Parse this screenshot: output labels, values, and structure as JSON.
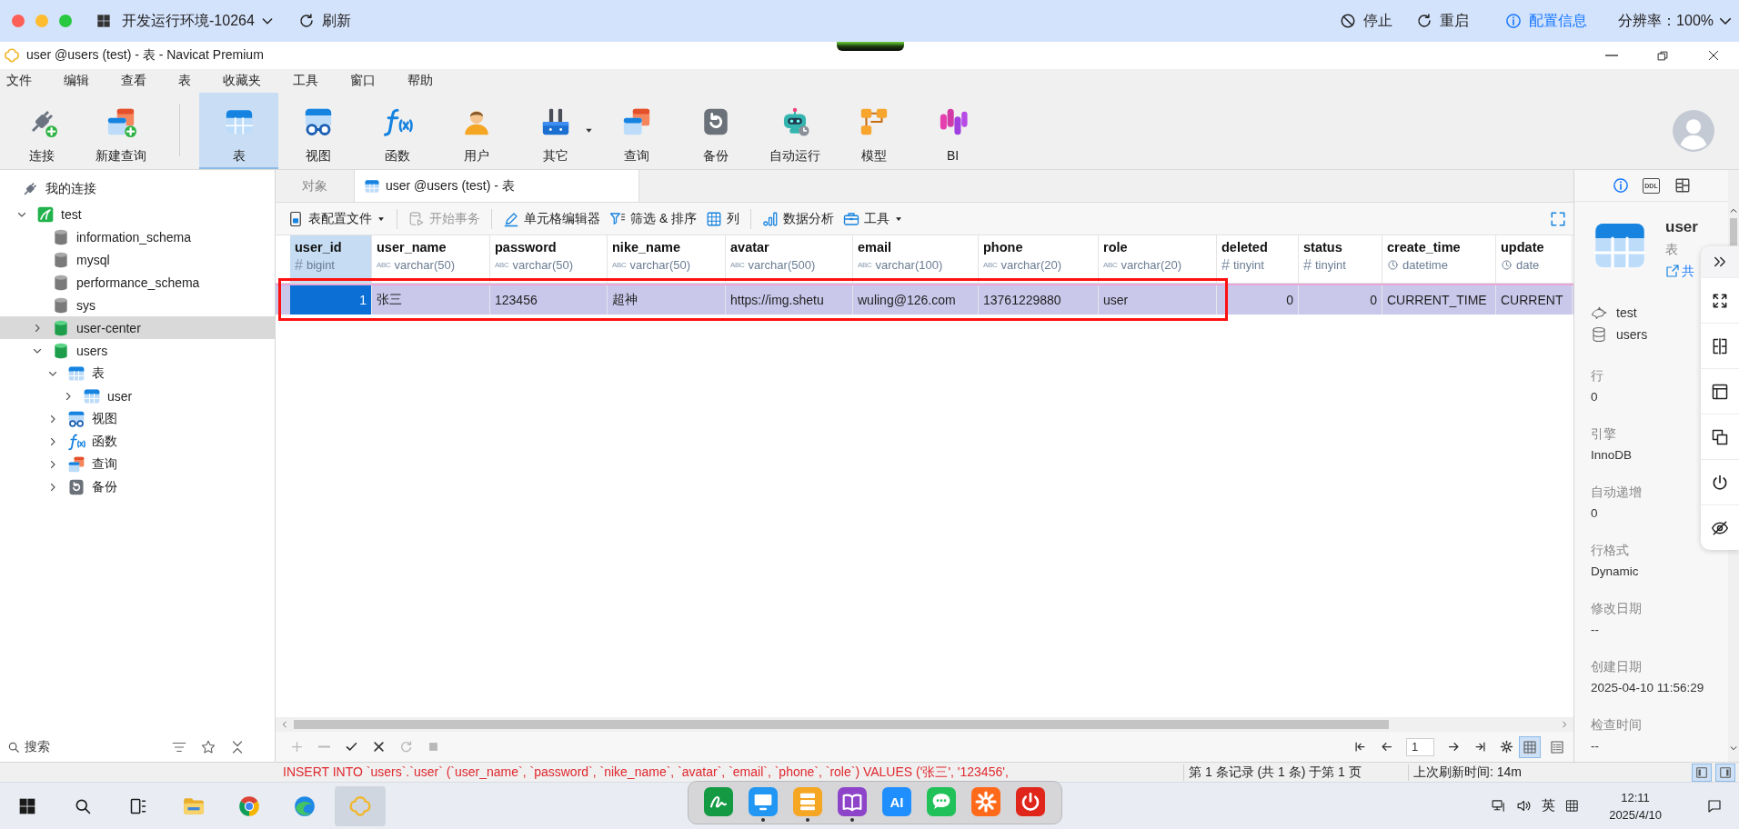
{
  "remote_bar": {
    "title": "开发运行环境-10264",
    "refresh": "刷新",
    "actions": [
      {
        "kind": "stop",
        "label": "停止"
      },
      {
        "kind": "restart",
        "label": "重启"
      },
      {
        "kind": "config",
        "label": "配置信息"
      }
    ],
    "resolution": "分辨率：100%"
  },
  "window": {
    "title": "user @users (test) - 表 - Navicat Premium"
  },
  "menu": [
    "文件",
    "编辑",
    "查看",
    "表",
    "收藏夹",
    "工具",
    "窗口",
    "帮助"
  ],
  "toolbar": {
    "groups": [
      [
        {
          "kind": "connect",
          "label": "连接",
          "selected": false,
          "dropdown": false
        },
        {
          "kind": "new-query",
          "label": "新建查询",
          "selected": false,
          "dropdown": false
        }
      ],
      [
        {
          "kind": "table",
          "label": "表",
          "selected": true,
          "dropdown": false
        },
        {
          "kind": "view",
          "label": "视图",
          "selected": false,
          "dropdown": false
        },
        {
          "kind": "function",
          "label": "函数",
          "selected": false,
          "dropdown": false
        },
        {
          "kind": "user",
          "label": "用户",
          "selected": false,
          "dropdown": false
        },
        {
          "kind": "other",
          "label": "其它",
          "selected": false,
          "dropdown": true
        },
        {
          "kind": "query",
          "label": "查询",
          "selected": false,
          "dropdown": false
        },
        {
          "kind": "backup",
          "label": "备份",
          "selected": false,
          "dropdown": false
        },
        {
          "kind": "automation",
          "label": "自动运行",
          "selected": false,
          "dropdown": false
        },
        {
          "kind": "model",
          "label": "模型",
          "selected": false,
          "dropdown": false
        },
        {
          "kind": "bi",
          "label": "BI",
          "selected": false,
          "dropdown": false
        }
      ]
    ]
  },
  "sidebar": {
    "tree": [
      {
        "kind": "connections",
        "label": "我的连接",
        "selected": false,
        "children": [
          {
            "kind": "server",
            "label": "test",
            "selected": false,
            "expanded": true,
            "children": [
              {
                "kind": "database",
                "label": "information_schema",
                "selected": false,
                "open": false
              },
              {
                "kind": "database",
                "label": "mysql",
                "selected": false,
                "open": false
              },
              {
                "kind": "database",
                "label": "performance_schema",
                "selected": false,
                "open": false
              },
              {
                "kind": "database",
                "label": "sys",
                "selected": false,
                "open": false
              },
              {
                "kind": "database",
                "label": "user-center",
                "selected": true,
                "open": true,
                "expanded": false
              },
              {
                "kind": "database",
                "label": "users",
                "selected": false,
                "open": true,
                "expanded": true,
                "children": [
                  {
                    "kind": "tables",
                    "label": "表",
                    "selected": false,
                    "expanded": true,
                    "children": [
                      {
                        "kind": "table",
                        "label": "user",
                        "selected": false,
                        "expanded": false
                      }
                    ]
                  },
                  {
                    "kind": "views",
                    "label": "视图",
                    "selected": false,
                    "expanded": false
                  },
                  {
                    "kind": "functions",
                    "label": "函数",
                    "selected": false,
                    "expanded": false
                  },
                  {
                    "kind": "queries",
                    "label": "查询",
                    "selected": false,
                    "expanded": false
                  },
                  {
                    "kind": "backups",
                    "label": "备份",
                    "selected": false,
                    "expanded": false
                  }
                ]
              }
            ]
          }
        ]
      }
    ],
    "search": {
      "placeholder": "搜索"
    }
  },
  "tabs": [
    {
      "kind": "objects",
      "label": "对象",
      "selected": false
    },
    {
      "kind": "table",
      "label": "user @users (test) - 表",
      "selected": true
    }
  ],
  "grid_toolbar": {
    "groups": [
      [
        {
          "kind": "profile",
          "label": "表配置文件",
          "disabled": false,
          "dropdown": true
        }
      ],
      [
        {
          "kind": "transaction",
          "label": "开始事务",
          "disabled": true,
          "dropdown": false
        }
      ],
      [
        {
          "kind": "cell-editor",
          "label": "单元格编辑器",
          "disabled": false,
          "dropdown": false
        },
        {
          "kind": "filter",
          "label": "筛选 & 排序",
          "disabled": false,
          "dropdown": false
        },
        {
          "kind": "columns",
          "label": "列",
          "disabled": false,
          "dropdown": false
        }
      ],
      [
        {
          "kind": "analysis",
          "label": "数据分析",
          "disabled": false,
          "dropdown": false
        },
        {
          "kind": "tools",
          "label": "工具",
          "disabled": false,
          "dropdown": true
        }
      ]
    ]
  },
  "table": {
    "columns": [
      {
        "name": "user_id",
        "type": "bigint",
        "kind": "number",
        "type_mark": "#",
        "selected": true
      },
      {
        "name": "user_name",
        "type": "varchar(50)",
        "kind": "text",
        "type_mark": "ABC",
        "selected": false
      },
      {
        "name": "password",
        "type": "varchar(50)",
        "kind": "text",
        "type_mark": "ABC",
        "selected": false
      },
      {
        "name": "nike_name",
        "type": "varchar(50)",
        "kind": "text",
        "type_mark": "ABC",
        "selected": false
      },
      {
        "name": "avatar",
        "type": "varchar(500)",
        "kind": "text",
        "type_mark": "ABC",
        "selected": false
      },
      {
        "name": "email",
        "type": "varchar(100)",
        "kind": "text",
        "type_mark": "ABC",
        "selected": false
      },
      {
        "name": "phone",
        "type": "varchar(20)",
        "kind": "text",
        "type_mark": "ABC",
        "selected": false
      },
      {
        "name": "role",
        "type": "varchar(20)",
        "kind": "text",
        "type_mark": "ABC",
        "selected": false
      },
      {
        "name": "deleted",
        "type": "tinyint",
        "kind": "number",
        "type_mark": "#",
        "selected": false
      },
      {
        "name": "status",
        "type": "tinyint",
        "kind": "number",
        "type_mark": "#",
        "selected": false
      },
      {
        "name": "create_time",
        "type": "datetime",
        "kind": "datetime",
        "selected": false
      },
      {
        "name": "update",
        "type": "date",
        "kind": "datetime",
        "selected": false
      }
    ],
    "rows": [
      {
        "selected": true,
        "framed": true,
        "cells": [
          "1",
          "张三",
          "123456",
          "超神",
          "https://img.shetu",
          "wuling@126.com",
          "13761229880",
          "user",
          "0",
          "0",
          "CURRENT_TIME",
          "CURRENT"
        ]
      }
    ]
  },
  "grid_footer": {
    "actions": [
      {
        "kind": "add",
        "disabled": true
      },
      {
        "kind": "remove",
        "disabled": true
      },
      {
        "kind": "apply",
        "disabled": false
      },
      {
        "kind": "discard",
        "disabled": false
      },
      {
        "kind": "refresh",
        "disabled": true
      },
      {
        "kind": "stop",
        "disabled": true
      }
    ],
    "page": "1",
    "views": [
      {
        "kind": "grid",
        "selected": true
      },
      {
        "kind": "form",
        "selected": false
      }
    ]
  },
  "info_panel": {
    "tabs": [
      {
        "kind": "info",
        "selected": true
      },
      {
        "kind": "ddl",
        "label": "DDL",
        "selected": false
      },
      {
        "kind": "columns",
        "selected": false
      }
    ],
    "name": "user",
    "type": "表",
    "share": "共",
    "connection": "test",
    "database": "users",
    "properties": [
      {
        "label": "行",
        "value": "0"
      },
      {
        "label": "引擎",
        "value": "InnoDB"
      },
      {
        "label": "自动递增",
        "value": "0"
      },
      {
        "label": "行格式",
        "value": "Dynamic"
      },
      {
        "label": "修改日期",
        "value": "--"
      },
      {
        "label": "创建日期",
        "value": "2025-04-10 11:56:29"
      },
      {
        "label": "检查时间",
        "value": "--"
      }
    ]
  },
  "status_bar": {
    "sql": "INSERT INTO `users`.`user` (`user_name`, `password`, `nike_name`, `avatar`, `email`, `phone`, `role`) VALUES ('张三', '123456',",
    "record": "第 1 条记录 (共 1 条) 于第 1 页",
    "refreshed": "上次刷新时间: 14m",
    "layouts": [
      {
        "kind": "left-panel",
        "selected": true
      },
      {
        "kind": "right-panel",
        "selected": true
      }
    ]
  },
  "taskbar": {
    "apps": [
      {
        "kind": "start",
        "selected": false
      },
      {
        "kind": "search",
        "selected": false
      },
      {
        "kind": "task-view",
        "selected": false
      },
      {
        "kind": "explorer",
        "selected": false
      },
      {
        "kind": "browser-round",
        "selected": false
      },
      {
        "kind": "browser-wave",
        "selected": false
      },
      {
        "kind": "navicat",
        "selected": true
      }
    ],
    "dock": [
      {
        "kind": "sign",
        "running": false
      },
      {
        "kind": "monitor",
        "running": true
      },
      {
        "kind": "server",
        "running": true
      },
      {
        "kind": "book",
        "running": true
      },
      {
        "kind": "ai",
        "label": "AI",
        "running": false
      },
      {
        "kind": "chat",
        "running": false
      },
      {
        "kind": "settings",
        "running": false
      },
      {
        "kind": "power",
        "running": false
      }
    ],
    "tray": {
      "ime": "英",
      "time": "12:11",
      "date": "2025/4/10"
    }
  }
}
